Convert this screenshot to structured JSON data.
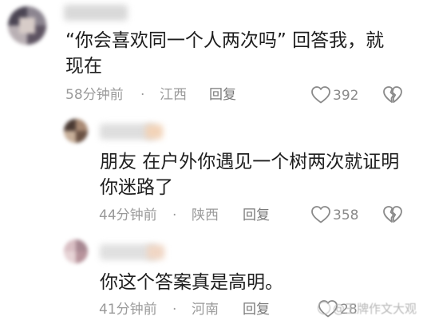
{
  "comments": [
    {
      "text_line1": "“你会喜欢同一个人两次吗”  回答我，就",
      "text_line2": "现在",
      "time": "58分钟前",
      "dot": "·",
      "location": "江西",
      "reply_label": "回复",
      "likes": "392"
    },
    {
      "text_line1": "朋友  在户外你遇见一个树两次就证明",
      "text_line2": "你迷路了",
      "time": "44分钟前",
      "dot": "·",
      "location": "陕西",
      "reply_label": "回复",
      "likes": "358"
    },
    {
      "text_line1": "你这个答案真是高明。",
      "time": "41分钟前",
      "dot": "·",
      "location": "河南",
      "reply_label": "回复",
      "likes": "28"
    }
  ],
  "watermark": "@王牌作文大观",
  "icons": {
    "like": "heart-outline-icon",
    "dislike": "broken-heart-icon",
    "watermark": "weibo-logo-icon"
  },
  "colors": {
    "meta_text": "#9a9a9a",
    "body_text": "#1e1e1e",
    "icon_stroke": "#8a8a8a"
  }
}
